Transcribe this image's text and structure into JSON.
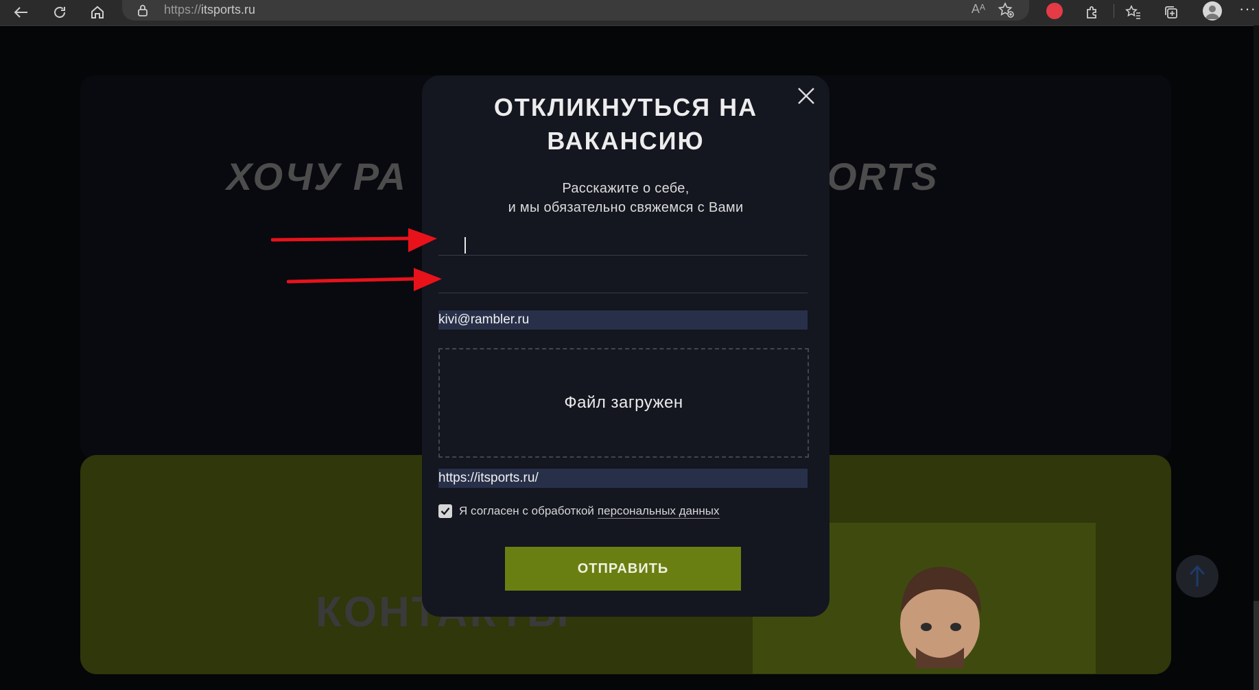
{
  "browser": {
    "url_protocol": "https://",
    "url_host": "itsports.ru",
    "read_aloud_label": "Aᴬ",
    "more_label": "···"
  },
  "background": {
    "title_left": "ХОЧУ РА",
    "title_right": "ORTS",
    "contacts_title": "КОНТАКТЫ"
  },
  "modal": {
    "title_line1": "ОТКЛИКНУТЬСЯ НА",
    "title_line2": "ВАКАНСИЮ",
    "subtitle_line1": "Расскажите о себе,",
    "subtitle_line2": "и мы обязательно свяжемся с Вами",
    "name_value": "",
    "phone_value": "",
    "email_value": "kivi@rambler.ru",
    "upload_status": "Файл загружен",
    "link_value": "https://itsports.ru/",
    "consent_text": "Я согласен с обработкой",
    "consent_link": "персональных данных",
    "consent_checked": true,
    "submit_label": "ОТПРАВИТЬ"
  },
  "colors": {
    "accent_green": "#6a7f12",
    "annotation_arrow": "#e8121b",
    "modal_bg": "#141620"
  }
}
